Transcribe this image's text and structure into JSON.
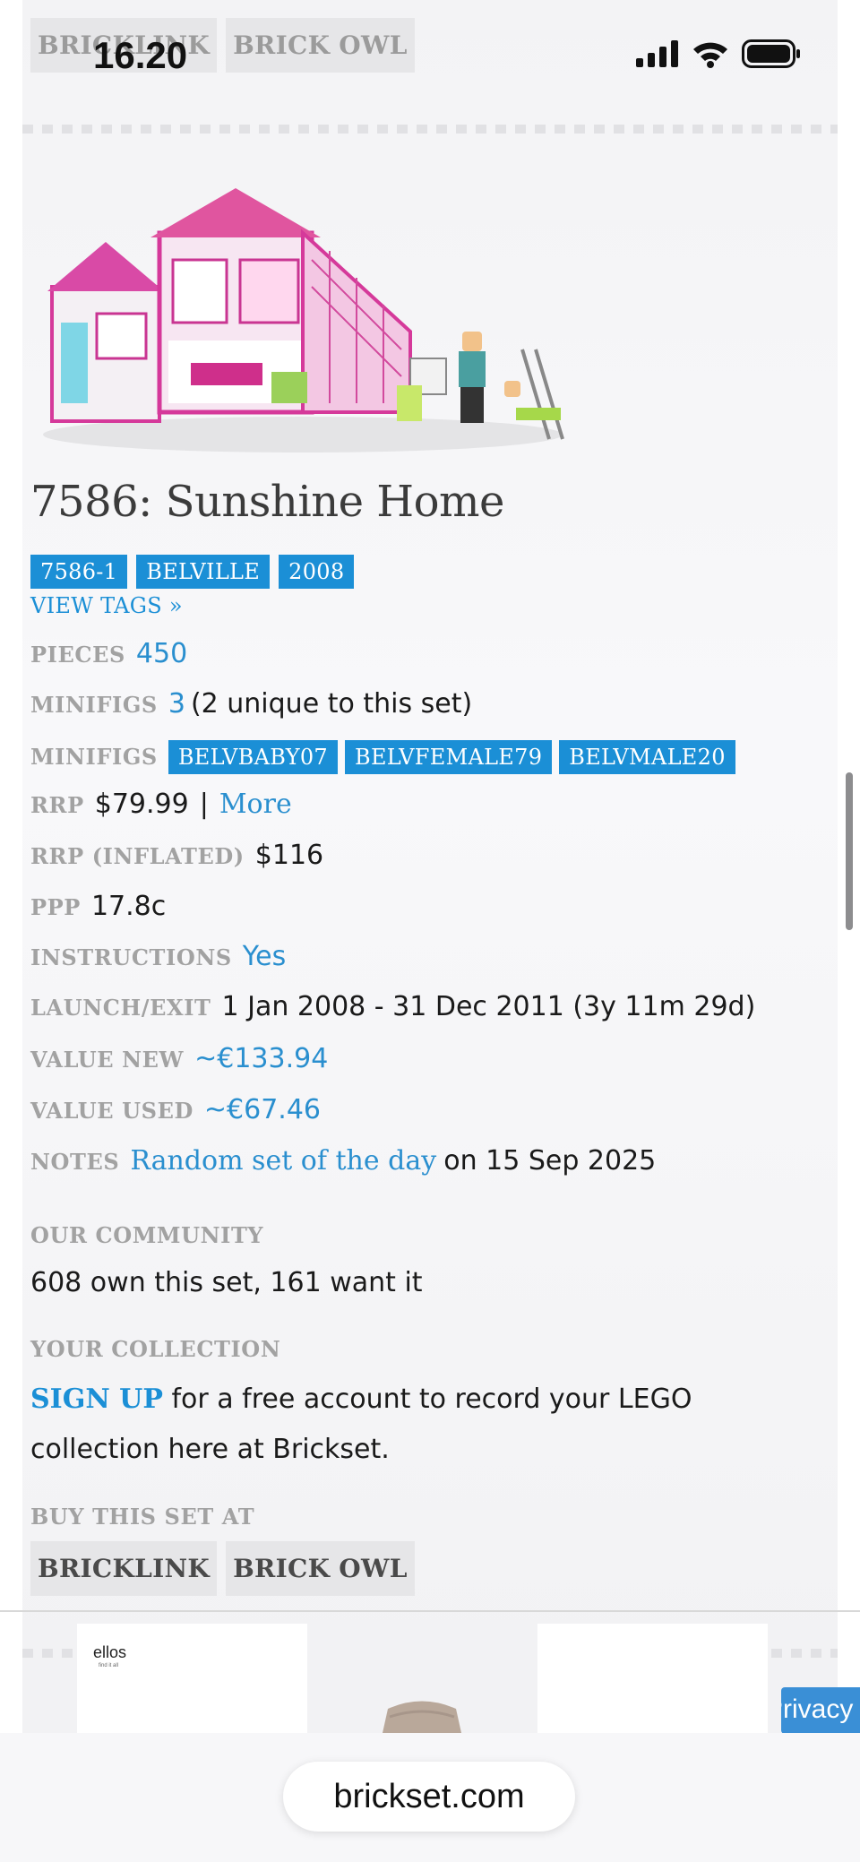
{
  "status_bar": {
    "time": "16.20"
  },
  "top_shops": [
    "BRICKLINK",
    "BRICK OWL"
  ],
  "set": {
    "title": "7586: Sunshine Home",
    "tags": [
      "7586-1",
      "BELVILLE",
      "2008"
    ],
    "view_tags": "VIEW TAGS »"
  },
  "details": {
    "pieces_label": "PIECES",
    "pieces_value": "450",
    "minifigs_label": "MINIFIGS",
    "minifigs_count": "3",
    "minifigs_note": "(2 unique to this set)",
    "minifigs2_label": "MINIFIGS",
    "minifig_tags": [
      "BELVBABY07",
      "BELVFEMALE79",
      "BELVMALE20"
    ],
    "rrp_label": "RRP",
    "rrp_value": "$79.99",
    "rrp_sep": "|",
    "rrp_more": "More",
    "rrp_inflated_label": "RRP (INFLATED)",
    "rrp_inflated_value": "$116",
    "ppp_label": "PPP",
    "ppp_value": "17.8c",
    "instructions_label": "INSTRUCTIONS",
    "instructions_value": "Yes",
    "launch_label": "LAUNCH/EXIT",
    "launch_value": "1 Jan 2008 - 31 Dec 2011 (3y 11m 29d)",
    "value_new_label": "VALUE NEW",
    "value_new": "~€133.94",
    "value_used_label": "VALUE USED",
    "value_used": "~€67.46",
    "notes_label": "NOTES",
    "notes_link": "Random set of the day",
    "notes_text": "on 15 Sep 2025"
  },
  "community": {
    "heading": "OUR COMMUNITY",
    "text": "608 own this set, 161 want it"
  },
  "collection": {
    "heading": "YOUR COLLECTION",
    "signup": "SIGN UP",
    "text": "for a free account to record your LEGO collection here at Brickset."
  },
  "buy": {
    "heading": "BUY THIS SET AT",
    "shops": [
      "BRICKLINK",
      "BRICK OWL"
    ]
  },
  "ad": {
    "logo": "ellos",
    "sub": "find it all",
    "privacy": "Privacy"
  },
  "browser": {
    "url": "brickset.com"
  },
  "colors": {
    "tag_blue": "#1b8fd6",
    "link_blue": "#2a8fcf",
    "label_grey": "#a2a2a2"
  }
}
